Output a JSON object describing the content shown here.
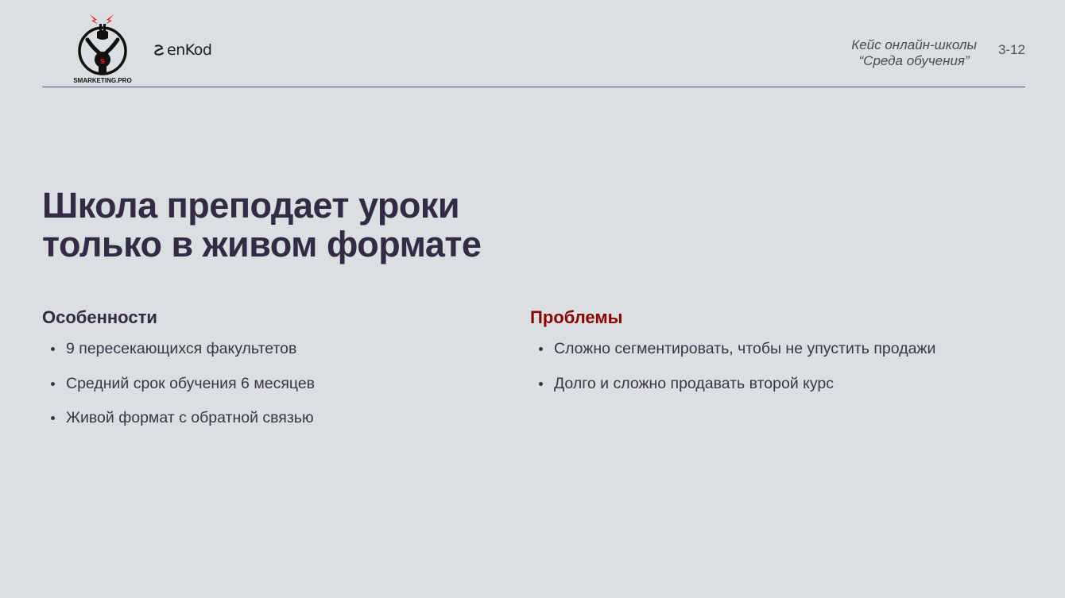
{
  "header": {
    "smarketing_logo_text": "SMARKETING.PRO",
    "enkod_logo_text": "enKod",
    "case_title_line1": "Кейс онлайн-школы",
    "case_title_line2": "“Среда обучения”",
    "page_number": "3-12"
  },
  "main": {
    "title_line1": "Школа преподает уроки",
    "title_line2": "только в живом формате"
  },
  "features": {
    "heading": "Особенности",
    "items": [
      "9 пересекающихся факультетов",
      "Средний срок обучения 6 месяцев",
      "Живой формат с обратной связью"
    ]
  },
  "problems": {
    "heading": "Проблемы",
    "items": [
      "Сложно сегментировать, чтобы не упустить продажи",
      "Долго и сложно продавать второй курс"
    ]
  },
  "colors": {
    "background": "#dadfe1",
    "title": "#332a45",
    "problems_heading": "#8b0000",
    "rule": "#5a4a7a",
    "logo_accent": "#e01b1b"
  }
}
